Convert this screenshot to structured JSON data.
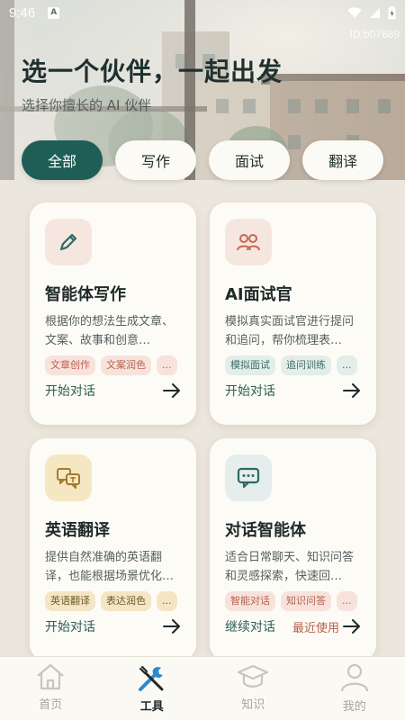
{
  "status_bar": {
    "time": "9:46",
    "notification_badge": "A"
  },
  "hero": {
    "id_label": "ID:b07689",
    "title": "选一个伙伴，一起出发",
    "subtitle": "选择你擅长的 AI 伙伴"
  },
  "filters": {
    "selected": "全部",
    "items": [
      {
        "label": "全部"
      },
      {
        "label": "写作"
      },
      {
        "label": "面试"
      },
      {
        "label": "翻译"
      }
    ]
  },
  "cards": [
    {
      "title": "智能体写作",
      "description": "根据你的想法生成文章、文案、故事和创意…",
      "icon": "pencil-icon",
      "tags": [
        "文章创作",
        "文案润色",
        "..."
      ],
      "action_label": "开始对话"
    },
    {
      "title": "AI面试官",
      "description": "模拟真实面试官进行提问和追问，帮你梳理表…",
      "icon": "people-icon",
      "tags": [
        "模拟面试",
        "追问训练",
        "..."
      ],
      "action_label": "开始对话"
    },
    {
      "title": "英语翻译",
      "description": "提供自然准确的英语翻译，也能根据场景优化…",
      "icon": "translate-icon",
      "tags": [
        "英语翻译",
        "表达润色",
        "..."
      ],
      "action_label": "开始对话"
    },
    {
      "title": "对话智能体",
      "description": "适合日常聊天、知识问答和灵感探索，快速回…",
      "icon": "chat-icon",
      "tags": [
        "智能对话",
        "知识问答",
        "..."
      ],
      "action_label": "继续对话",
      "recent_label": "最近使用"
    }
  ],
  "bottom_nav": {
    "active": "工具",
    "items": [
      {
        "label": "首页",
        "icon": "home-icon"
      },
      {
        "label": "工具",
        "icon": "tools-icon"
      },
      {
        "label": "知识",
        "icon": "graduation-cap-icon"
      },
      {
        "label": "我的",
        "icon": "user-icon"
      }
    ]
  },
  "colors": {
    "accent": "#1f5e57",
    "background": "#ece7de",
    "card": "#fdfbf5",
    "recent": "#b45f4a"
  }
}
